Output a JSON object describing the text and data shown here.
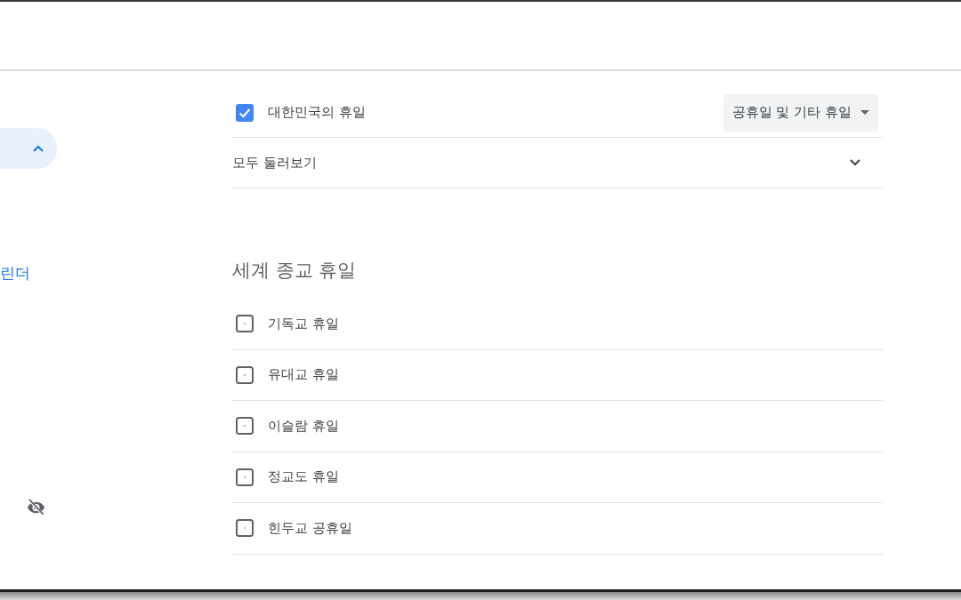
{
  "sidebar": {
    "section": {
      "expanded": true
    },
    "link": "린더"
  },
  "national_holidays": {
    "label": "대한민국의 휴일",
    "checked": true,
    "dropdown": {
      "value": "공휴일 및 기타 휴일"
    }
  },
  "browse_all": {
    "label": "모두 둘러보기",
    "expanded": false
  },
  "religious_holidays": {
    "title": "세계 종교 휴일",
    "items": [
      {
        "label": "기독교 휴일",
        "checked": false
      },
      {
        "label": "유대교 휴일",
        "checked": false
      },
      {
        "label": "이슬람 휴일",
        "checked": false
      },
      {
        "label": "정교도 휴일",
        "checked": false
      },
      {
        "label": "힌두교 공휴일",
        "checked": false
      }
    ]
  }
}
